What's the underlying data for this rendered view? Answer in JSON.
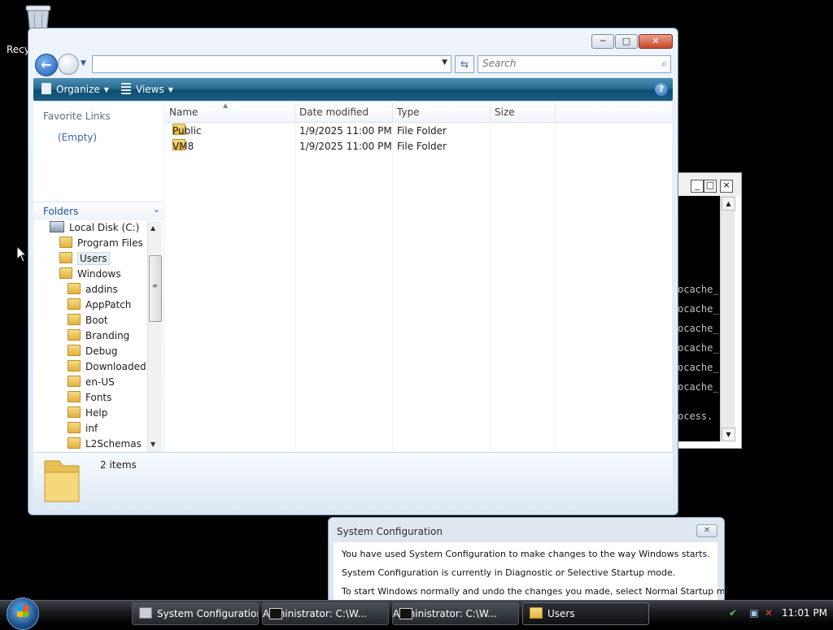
{
  "desktop": {
    "recycle_bin_label": "Recy"
  },
  "console": {
    "buttons": [
      "_",
      "□",
      "×"
    ],
    "lines": [
      "ocache_",
      "ocache_",
      "ocache_",
      "ocache_",
      "ocache_",
      "ocache_",
      "ocess."
    ]
  },
  "explorer": {
    "caption": {
      "minimize": "─",
      "maximize": "□",
      "close": "✕"
    },
    "address_value": "",
    "search_placeholder": "Search",
    "toolbar": {
      "organize": "Organize",
      "views": "Views",
      "help": "?"
    },
    "favorites": {
      "title": "Favorite Links",
      "empty": "(Empty)"
    },
    "folders": {
      "title": "Folders",
      "items": [
        {
          "label": "Local Disk (C:)",
          "level": 0,
          "icon": "drive"
        },
        {
          "label": "Program Files",
          "level": 1,
          "icon": "folder"
        },
        {
          "label": "Users",
          "level": 1,
          "icon": "folder",
          "selected": true
        },
        {
          "label": "Windows",
          "level": 1,
          "icon": "folder"
        },
        {
          "label": "addins",
          "level": 2,
          "icon": "folder"
        },
        {
          "label": "AppPatch",
          "level": 2,
          "icon": "folder"
        },
        {
          "label": "Boot",
          "level": 2,
          "icon": "folder"
        },
        {
          "label": "Branding",
          "level": 2,
          "icon": "folder"
        },
        {
          "label": "Debug",
          "level": 2,
          "icon": "folder"
        },
        {
          "label": "Downloaded P",
          "level": 2,
          "icon": "folder"
        },
        {
          "label": "en-US",
          "level": 2,
          "icon": "folder"
        },
        {
          "label": "Fonts",
          "level": 2,
          "icon": "folder"
        },
        {
          "label": "Help",
          "level": 2,
          "icon": "folder"
        },
        {
          "label": "inf",
          "level": 2,
          "icon": "folder"
        },
        {
          "label": "L2Schemas",
          "level": 2,
          "icon": "folder"
        }
      ]
    },
    "columns": {
      "name": "Name",
      "date": "Date modified",
      "type": "Type",
      "size": "Size"
    },
    "files": [
      {
        "name": "Public",
        "date": "1/9/2025 11:00 PM",
        "type": "File Folder",
        "size": ""
      },
      {
        "name": "VM8",
        "date": "1/9/2025 11:00 PM",
        "type": "File Folder",
        "size": ""
      }
    ],
    "details": {
      "count": "2 items"
    }
  },
  "sysconfig": {
    "title": "System Configuration",
    "close": "✕",
    "lines": [
      "You have used System Configuration to make changes to the way Windows starts.",
      "System Configuration is currently in Diagnostic or Selective Startup mode.",
      "To start Windows normally and undo the changes you made, select Normal Startup mode on"
    ]
  },
  "taskbar": {
    "buttons": [
      {
        "label": "System Configuration",
        "icon": "sysconfig-icon"
      },
      {
        "label": "Administrator: C:\\W...",
        "icon": "cmd-icon"
      },
      {
        "label": "Administrator: C:\\W...",
        "icon": "cmd-icon"
      },
      {
        "label": "Users",
        "icon": "folder-icon",
        "active": true
      }
    ],
    "clock": "11:01 PM"
  },
  "colors": {
    "accent": "#1b5cb3",
    "command_bar": "#1a5e86",
    "link": "#3c64a6"
  }
}
